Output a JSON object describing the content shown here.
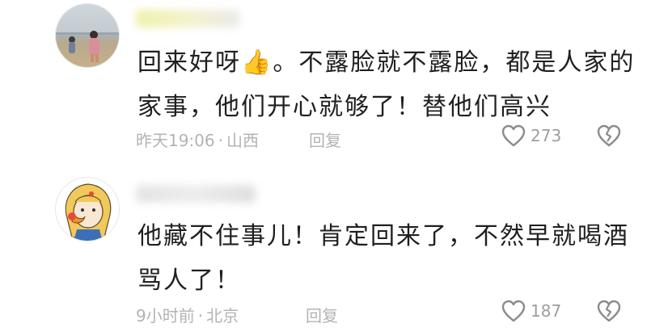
{
  "comments": [
    {
      "text": "回来好呀👍。不露脸就不露脸，都是人家的家事，他们开心就够了！替他们高兴",
      "time": "昨天19:06",
      "location": "山西",
      "reply_label": "回复",
      "like_count": "273",
      "icons": {
        "like": "heart-icon",
        "dislike": "broken-heart-icon"
      }
    },
    {
      "text": "他藏不住事儿！肯定回来了，不然早就喝酒骂人了！",
      "time": "9小时前",
      "location": "北京",
      "reply_label": "回复",
      "like_count": "187",
      "icons": {
        "like": "heart-icon",
        "dislike": "broken-heart-icon"
      }
    }
  ],
  "separator": "·"
}
